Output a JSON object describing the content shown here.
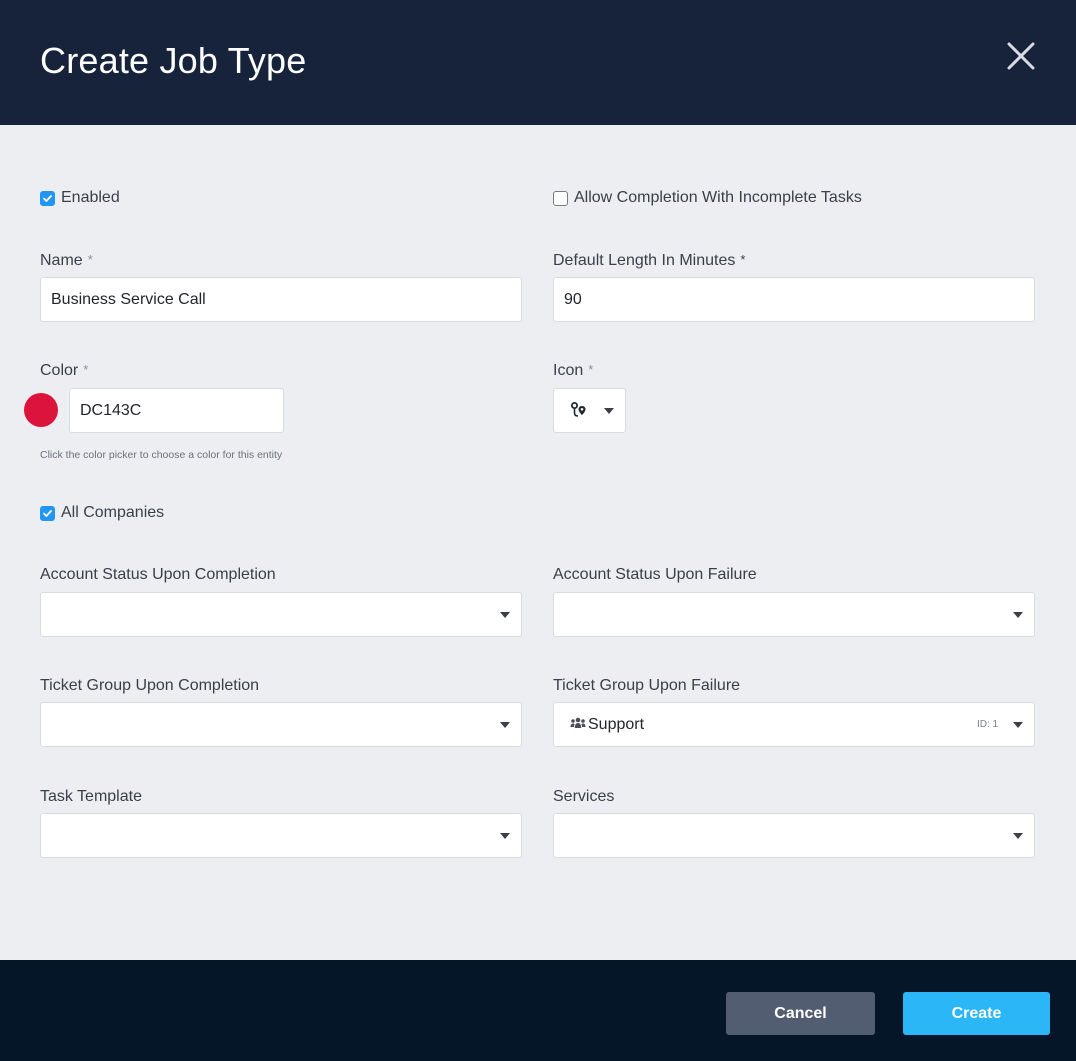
{
  "header": {
    "title": "Create Job Type",
    "close_icon": "close-icon"
  },
  "colors": {
    "header_bg": "#17233a",
    "footer_bg": "#041627",
    "accent": "#2bb6f8",
    "checkbox": "#2196f3",
    "swatch": "#DC143C",
    "cancel_bg": "#535d72"
  },
  "form": {
    "enabled": {
      "label": "Enabled",
      "checked": true
    },
    "allow_incomplete": {
      "label": "Allow Completion With Incomplete Tasks",
      "checked": false
    },
    "name": {
      "label": "Name",
      "required_mark": "*",
      "value": "Business Service Call"
    },
    "default_length": {
      "label": "Default Length In Minutes",
      "required_mark": "*",
      "value": "90"
    },
    "color": {
      "label": "Color",
      "required_mark": "*",
      "value": "DC143C",
      "hint": "Click the color picker to choose a color for this entity"
    },
    "icon": {
      "label": "Icon",
      "required_mark": "*",
      "selected_icon": "map-pin-route-icon"
    },
    "all_companies": {
      "label": "All Companies",
      "checked": true
    },
    "account_status_completion": {
      "label": "Account Status Upon Completion",
      "value": ""
    },
    "account_status_failure": {
      "label": "Account Status Upon Failure",
      "value": ""
    },
    "ticket_group_completion": {
      "label": "Ticket Group Upon Completion",
      "value": ""
    },
    "ticket_group_failure": {
      "label": "Ticket Group Upon Failure",
      "value": "Support",
      "id_badge": "ID: 1",
      "icon": "users-icon"
    },
    "task_template": {
      "label": "Task Template",
      "value": ""
    },
    "services": {
      "label": "Services",
      "value": ""
    }
  },
  "footer": {
    "cancel_label": "Cancel",
    "create_label": "Create"
  }
}
